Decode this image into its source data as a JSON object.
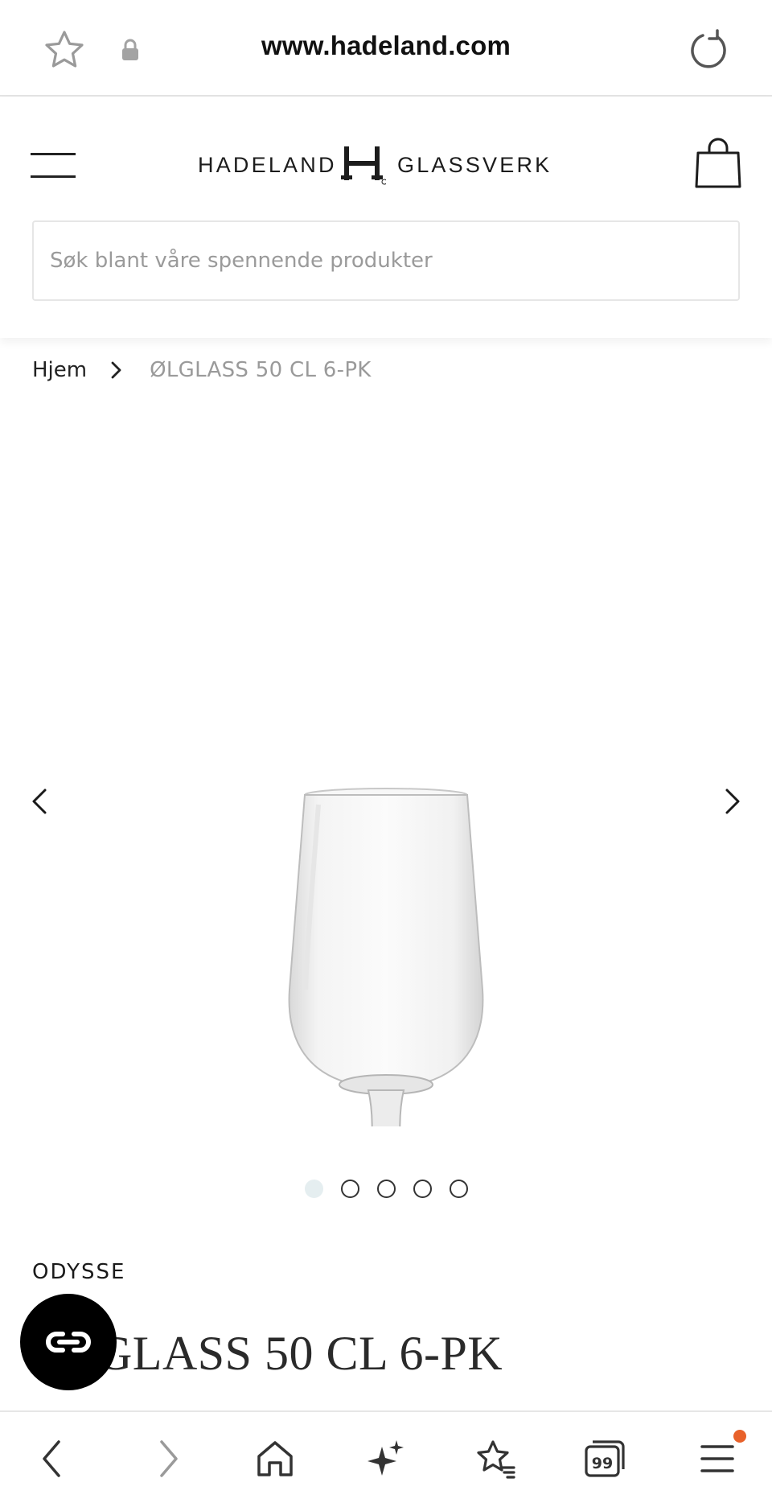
{
  "browser": {
    "url": "www.hadeland.com",
    "icons": [
      "star-outline-icon",
      "lock-icon",
      "reload-icon"
    ]
  },
  "header": {
    "logo_left": "HADELAND",
    "logo_right": "GLASSVERK",
    "search_placeholder": "Søk blant våre spennende produkter",
    "icons": [
      "hamburger-menu-icon",
      "shopping-bag-icon"
    ]
  },
  "breadcrumb": {
    "home": "Hjem",
    "current": "ØLGLASS 50 CL 6-PK"
  },
  "gallery": {
    "image_alt": "beer glass on stem",
    "slide_count": 5,
    "active_slide": 1
  },
  "product": {
    "brand": "ODYSSE",
    "title": "ØLGLASS 50 CL 6-PK"
  },
  "chat": {
    "icon": "chat-loop-icon"
  },
  "toolbar": {
    "tabs_count": "99",
    "notification_color": "#e8612a",
    "icons": [
      "back-icon",
      "forward-icon",
      "home-icon",
      "sparkle-icon",
      "bookmarks-icon",
      "tabs-icon",
      "menu-icon"
    ]
  }
}
